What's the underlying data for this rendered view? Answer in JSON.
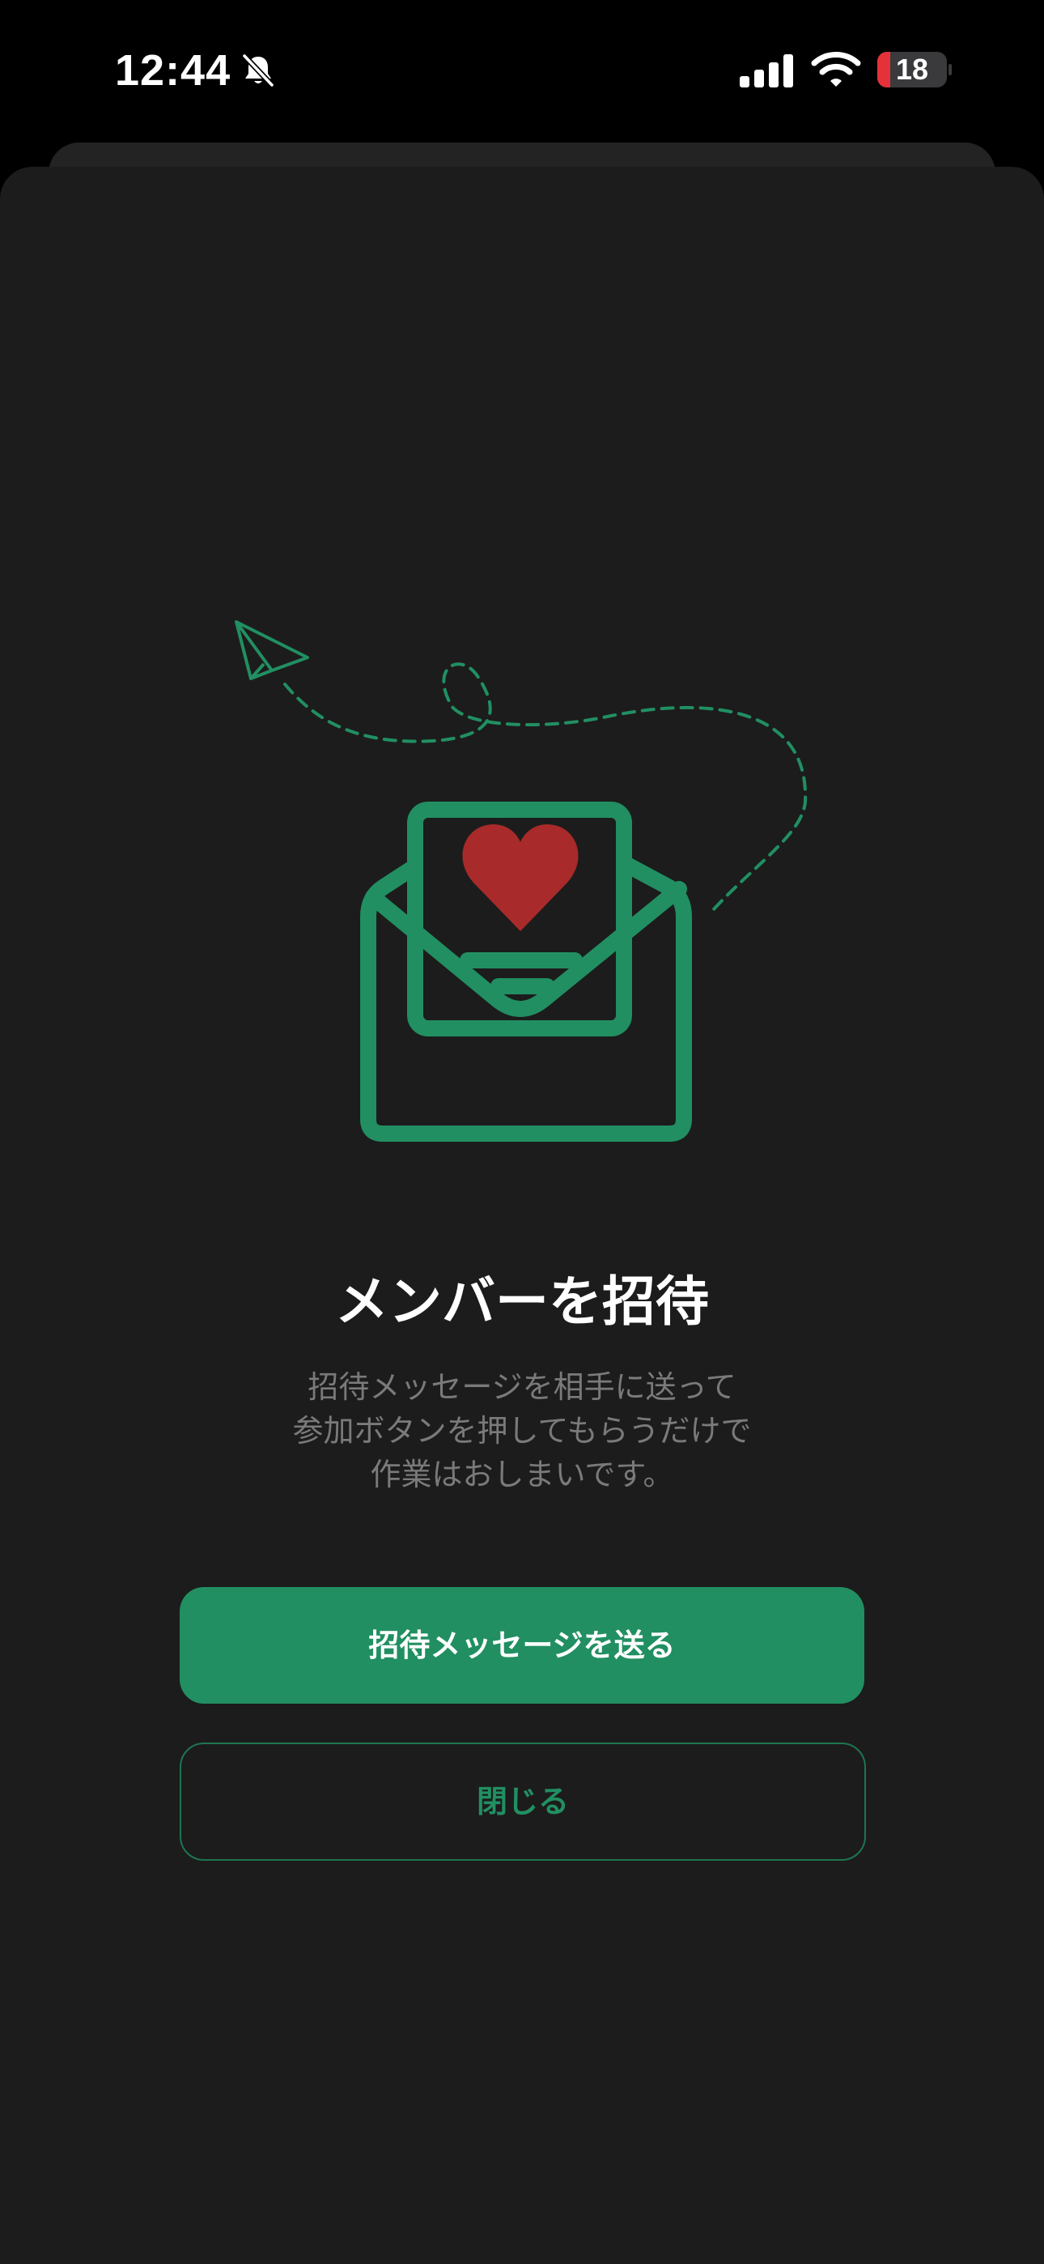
{
  "status_bar": {
    "time": "12:44",
    "battery_level": "18",
    "icons": [
      "bell-slash-icon",
      "cellular-signal-icon",
      "wifi-icon",
      "battery-icon"
    ]
  },
  "invite": {
    "title": "メンバーを招待",
    "description": [
      "招待メッセージを相手に送って",
      "参加ボタンを押してもらうだけで",
      "作業はおしまいです。"
    ],
    "illustration_icons": [
      "paper-plane-icon",
      "envelope-icon",
      "heart-icon"
    ]
  },
  "actions": {
    "send_label": "招待メッセージを送る",
    "close_label": "閉じる"
  },
  "colors": {
    "background": "#000000",
    "sheet": "#1c1c1c",
    "accent_green": "#218f62",
    "heart_red": "#a82a2a",
    "battery_low": "#e5323a",
    "muted_text": "#7a7a7a"
  }
}
